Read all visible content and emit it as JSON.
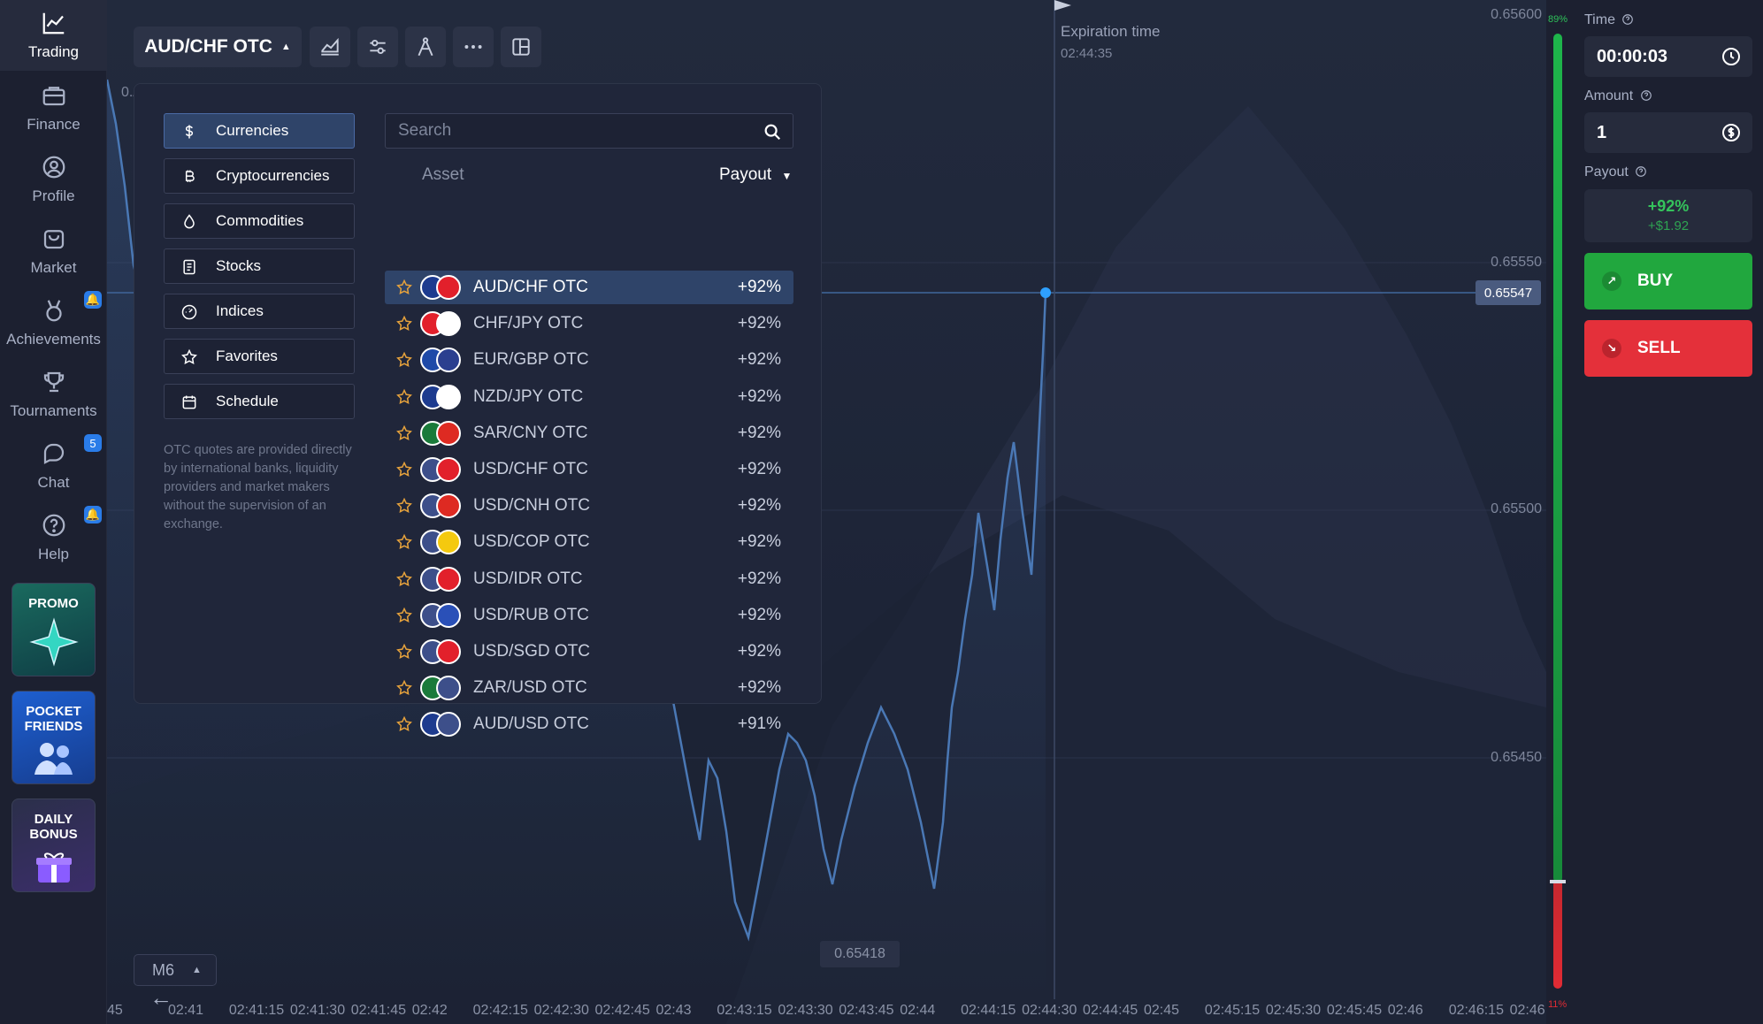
{
  "sidebar": {
    "items": [
      {
        "label": "Trading",
        "icon": "chart-line-icon",
        "active": true
      },
      {
        "label": "Finance",
        "icon": "briefcase-icon"
      },
      {
        "label": "Profile",
        "icon": "user-circle-icon"
      },
      {
        "label": "Market",
        "icon": "shopping-bag-icon"
      },
      {
        "label": "Achievements",
        "icon": "medal-icon"
      },
      {
        "label": "Tournaments",
        "icon": "trophy-icon"
      },
      {
        "label": "Chat",
        "icon": "chat-bubble-icon",
        "badge": "5"
      },
      {
        "label": "Help",
        "icon": "help-circle-icon"
      }
    ],
    "promo": "PROMO",
    "pocket_friends": "POCKET FRIENDS",
    "daily_bonus": "DAILY BONUS"
  },
  "toolbar": {
    "pair": "AUD/CHF OTC",
    "timeframe": "M6"
  },
  "panel": {
    "categories": [
      {
        "label": "Currencies",
        "icon": "dollar-icon",
        "active": true
      },
      {
        "label": "Cryptocurrencies",
        "icon": "bitcoin-icon"
      },
      {
        "label": "Commodities",
        "icon": "drop-icon"
      },
      {
        "label": "Stocks",
        "icon": "document-icon"
      },
      {
        "label": "Indices",
        "icon": "gauge-icon"
      },
      {
        "label": "Favorites",
        "icon": "star-icon"
      },
      {
        "label": "Schedule",
        "icon": "calendar-icon"
      }
    ],
    "note": "OTC quotes are provided directly by international banks, liquidity providers and market makers without the supervision of an exchange.",
    "search_placeholder": "Search",
    "col_asset": "Asset",
    "col_payout": "Payout",
    "assets": [
      {
        "name": "AUD/CHF OTC",
        "payout": "+92%",
        "f1": "#1d3b8f",
        "f2": "#e2202b",
        "active": true
      },
      {
        "name": "CHF/JPY OTC",
        "payout": "+92%",
        "f1": "#e2202b",
        "f2": "#ffffff"
      },
      {
        "name": "EUR/GBP OTC",
        "payout": "+92%",
        "f1": "#1f4aa8",
        "f2": "#2b3f8f"
      },
      {
        "name": "NZD/JPY OTC",
        "payout": "+92%",
        "f1": "#1d3b8f",
        "f2": "#ffffff"
      },
      {
        "name": "SAR/CNY OTC",
        "payout": "+92%",
        "f1": "#1a7a3a",
        "f2": "#de2a22"
      },
      {
        "name": "USD/CHF OTC",
        "payout": "+92%",
        "f1": "#3d4f8a",
        "f2": "#e2202b"
      },
      {
        "name": "USD/CNH OTC",
        "payout": "+92%",
        "f1": "#3d4f8a",
        "f2": "#de2a22"
      },
      {
        "name": "USD/COP OTC",
        "payout": "+92%",
        "f1": "#3d4f8a",
        "f2": "#f4c90f"
      },
      {
        "name": "USD/IDR OTC",
        "payout": "+92%",
        "f1": "#3d4f8a",
        "f2": "#e2202b"
      },
      {
        "name": "USD/RUB OTC",
        "payout": "+92%",
        "f1": "#3d4f8a",
        "f2": "#2a50b8"
      },
      {
        "name": "USD/SGD OTC",
        "payout": "+92%",
        "f1": "#3d4f8a",
        "f2": "#e2202b"
      },
      {
        "name": "ZAR/USD OTC",
        "payout": "+92%",
        "f1": "#1a7a3a",
        "f2": "#3d4f8a"
      },
      {
        "name": "AUD/USD OTC",
        "payout": "+91%",
        "f1": "#1d3b8f",
        "f2": "#3d4f8a"
      }
    ]
  },
  "chart": {
    "expiration_label": "Expiration time",
    "expiration_time": "02:44:35",
    "current_price": "0.65547",
    "min_price": "0.65418",
    "left_clip": "0./",
    "price_ticks": [
      "0.65600",
      "0.65550",
      "0.65500",
      "0.65450"
    ],
    "time_ticks": [
      "45",
      "02:41",
      "02:41:15",
      "02:41:30",
      "02:41:45",
      "02:42",
      "02:42:15",
      "02:42:30",
      "02:42:45",
      "02:43",
      "02:43:15",
      "02:43:30",
      "02:43:45",
      "02:44",
      "02:44:15",
      "02:44:30",
      "02:44:45",
      "02:45",
      "02:45:15",
      "02:45:30",
      "02:45:45",
      "02:46",
      "02:46:15",
      "02:46"
    ],
    "line_color": "#4a78b5"
  },
  "right_panel": {
    "pct_up": "89%",
    "pct_down": "11%",
    "time_label": "Time",
    "time_value": "00:00:03",
    "amount_label": "Amount",
    "amount_value": "1",
    "payout_label": "Payout",
    "payout_pct": "+92%",
    "payout_value": "+$1.92",
    "buy_label": "BUY",
    "sell_label": "SELL"
  }
}
